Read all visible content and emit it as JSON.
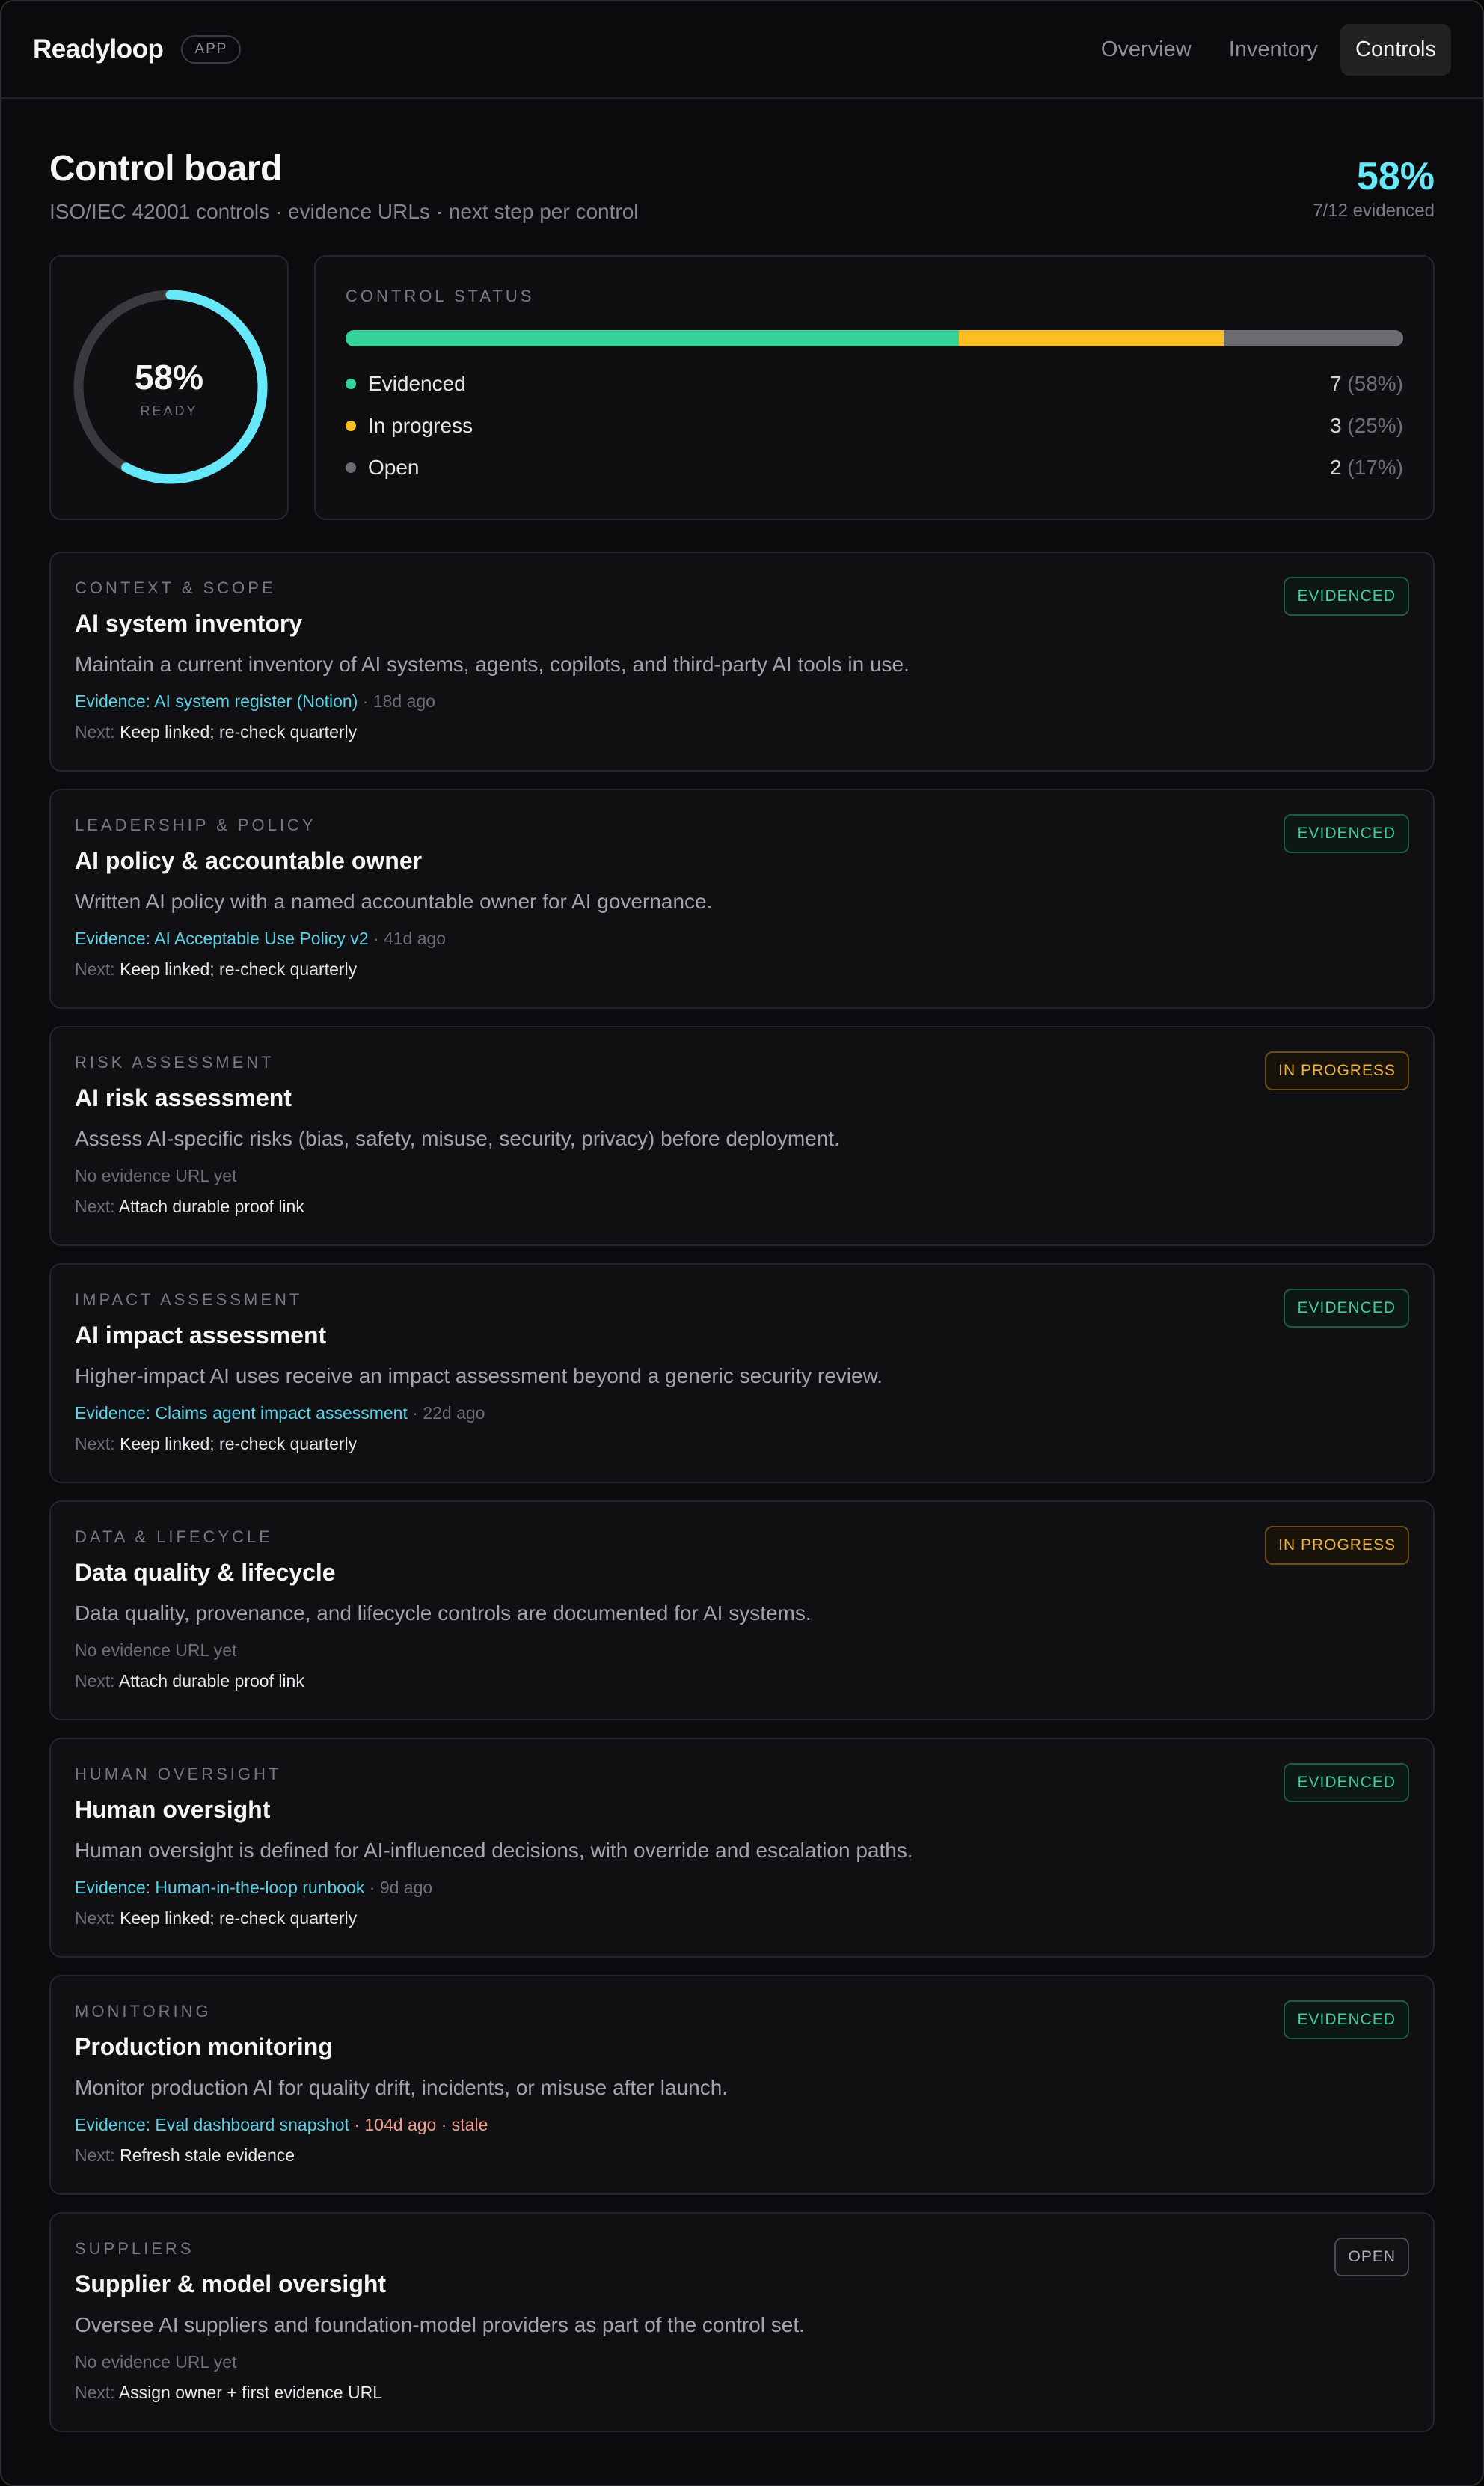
{
  "header": {
    "brand": "Readyloop",
    "app_pill": "APP",
    "nav": [
      {
        "label": "Overview",
        "active": false
      },
      {
        "label": "Inventory",
        "active": false
      },
      {
        "label": "Controls",
        "active": true
      }
    ]
  },
  "page": {
    "title": "Control board",
    "subtitle": "ISO/IEC 42001 controls · evidence URLs · next step per control",
    "score_pct": "58%",
    "score_count": "7/12 evidenced"
  },
  "ring": {
    "pct_label": "58%",
    "sub_label": "READY",
    "value": 0.58,
    "color": "#67e8f9",
    "track_color": "#3a3a3e"
  },
  "status": {
    "eyebrow": "CONTROL STATUS",
    "rows": [
      {
        "label": "Evidenced",
        "count": "7",
        "pct": "(58%)",
        "value": 0.58,
        "color": "#34d399"
      },
      {
        "label": "In progress",
        "count": "3",
        "pct": "(25%)",
        "value": 0.25,
        "color": "#fbbf24"
      },
      {
        "label": "Open",
        "count": "2",
        "pct": "(17%)",
        "value": 0.17,
        "color": "#6b6b70"
      }
    ]
  },
  "controls": [
    {
      "category": "CONTEXT & SCOPE",
      "title": "AI system inventory",
      "description": "Maintain a current inventory of AI systems, agents, copilots, and third-party AI tools in use.",
      "evidence_link": "Evidence: AI system register (Notion)",
      "evidence_age": " · 18d ago",
      "evidence_stale": "",
      "evidence_none": "",
      "next_label": "Next: ",
      "next_value": "Keep linked; re-check quarterly",
      "badge": "EVIDENCED",
      "status": "evidenced"
    },
    {
      "category": "LEADERSHIP & POLICY",
      "title": "AI policy & accountable owner",
      "description": "Written AI policy with a named accountable owner for AI governance.",
      "evidence_link": "Evidence: AI Acceptable Use Policy v2",
      "evidence_age": " · 41d ago",
      "evidence_stale": "",
      "evidence_none": "",
      "next_label": "Next: ",
      "next_value": "Keep linked; re-check quarterly",
      "badge": "EVIDENCED",
      "status": "evidenced"
    },
    {
      "category": "RISK ASSESSMENT",
      "title": "AI risk assessment",
      "description": "Assess AI-specific risks (bias, safety, misuse, security, privacy) before deployment.",
      "evidence_link": "",
      "evidence_age": "",
      "evidence_stale": "",
      "evidence_none": "No evidence URL yet",
      "next_label": "Next: ",
      "next_value": "Attach durable proof link",
      "badge": "IN PROGRESS",
      "status": "progress"
    },
    {
      "category": "IMPACT ASSESSMENT",
      "title": "AI impact assessment",
      "description": "Higher-impact AI uses receive an impact assessment beyond a generic security review.",
      "evidence_link": "Evidence: Claims agent impact assessment",
      "evidence_age": " · 22d ago",
      "evidence_stale": "",
      "evidence_none": "",
      "next_label": "Next: ",
      "next_value": "Keep linked; re-check quarterly",
      "badge": "EVIDENCED",
      "status": "evidenced"
    },
    {
      "category": "DATA & LIFECYCLE",
      "title": "Data quality & lifecycle",
      "description": "Data quality, provenance, and lifecycle controls are documented for AI systems.",
      "evidence_link": "",
      "evidence_age": "",
      "evidence_stale": "",
      "evidence_none": "No evidence URL yet",
      "next_label": "Next: ",
      "next_value": "Attach durable proof link",
      "badge": "IN PROGRESS",
      "status": "progress"
    },
    {
      "category": "HUMAN OVERSIGHT",
      "title": "Human oversight",
      "description": "Human oversight is defined for AI-influenced decisions, with override and escalation paths.",
      "evidence_link": "Evidence: Human-in-the-loop runbook",
      "evidence_age": " · 9d ago",
      "evidence_stale": "",
      "evidence_none": "",
      "next_label": "Next: ",
      "next_value": "Keep linked; re-check quarterly",
      "badge": "EVIDENCED",
      "status": "evidenced"
    },
    {
      "category": "MONITORING",
      "title": "Production monitoring",
      "description": "Monitor production AI for quality drift, incidents, or misuse after launch.",
      "evidence_link": "Evidence: Eval dashboard snapshot",
      "evidence_age": "",
      "evidence_stale": " · 104d ago · stale",
      "evidence_none": "",
      "next_label": "Next: ",
      "next_value": "Refresh stale evidence",
      "badge": "EVIDENCED",
      "status": "evidenced"
    },
    {
      "category": "SUPPLIERS",
      "title": "Supplier & model oversight",
      "description": "Oversee AI suppliers and foundation-model providers as part of the control set.",
      "evidence_link": "",
      "evidence_age": "",
      "evidence_stale": "",
      "evidence_none": "No evidence URL yet",
      "next_label": "Next: ",
      "next_value": "Assign owner + first evidence URL",
      "badge": "OPEN",
      "status": "open"
    }
  ]
}
